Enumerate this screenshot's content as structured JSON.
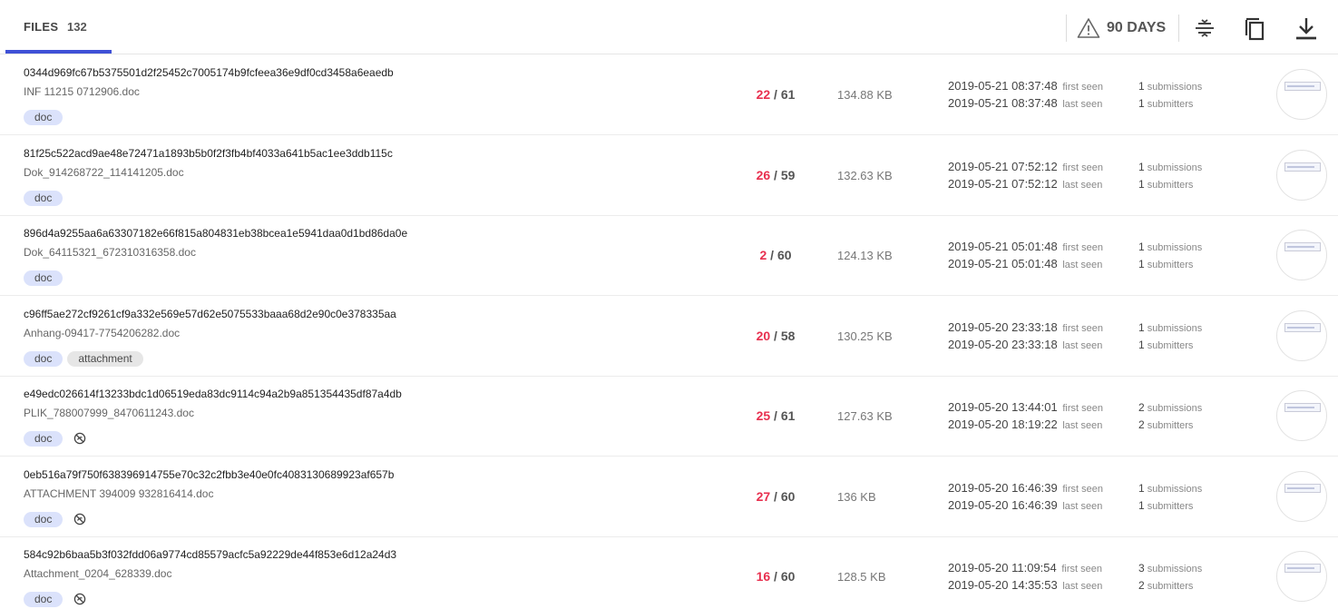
{
  "header": {
    "tab_label": "FILES",
    "tab_count": "132",
    "days_label": "90 DAYS",
    "icons": [
      "warning-triangle-icon",
      "filter-icon",
      "copy-icon",
      "download-icon"
    ],
    "accent_color": "#3f51d6"
  },
  "rows": [
    {
      "hash": "0344d969fc67b5375501d2f25452c7005174b9fcfeea36e9df0cd3458a6eaedb",
      "name": "INF 11215 0712906.doc",
      "tags": [
        "doc"
      ],
      "has_icon": false,
      "det_pos": "22",
      "det_total": "61",
      "size": "134.88 KB",
      "first_seen": "2019-05-21 08:37:48",
      "first_label": "first seen",
      "last_seen": "2019-05-21 08:37:48",
      "last_label": "last seen",
      "submissions": "1",
      "submissions_label": "submissions",
      "submitters": "1",
      "submitters_label": "submitters"
    },
    {
      "hash": "81f25c522acd9ae48e72471a1893b5b0f2f3fb4bf4033a641b5ac1ee3ddb115c",
      "name": "Dok_914268722_114141205.doc",
      "tags": [
        "doc"
      ],
      "has_icon": false,
      "det_pos": "26",
      "det_total": "59",
      "size": "132.63 KB",
      "first_seen": "2019-05-21 07:52:12",
      "first_label": "first seen",
      "last_seen": "2019-05-21 07:52:12",
      "last_label": "last seen",
      "submissions": "1",
      "submissions_label": "submissions",
      "submitters": "1",
      "submitters_label": "submitters"
    },
    {
      "hash": "896d4a9255aa6a63307182e66f815a804831eb38bcea1e5941daa0d1bd86da0e",
      "name": "Dok_64115321_672310316358.doc",
      "tags": [
        "doc"
      ],
      "has_icon": false,
      "det_pos": "2",
      "det_total": "60",
      "size": "124.13 KB",
      "first_seen": "2019-05-21 05:01:48",
      "first_label": "first seen",
      "last_seen": "2019-05-21 05:01:48",
      "last_label": "last seen",
      "submissions": "1",
      "submissions_label": "submissions",
      "submitters": "1",
      "submitters_label": "submitters"
    },
    {
      "hash": "c96ff5ae272cf9261cf9a332e569e57d62e5075533baaa68d2e90c0e378335aa",
      "name": "Anhang-09417-7754206282.doc",
      "tags": [
        "doc",
        "attachment"
      ],
      "has_icon": false,
      "det_pos": "20",
      "det_total": "58",
      "size": "130.25 KB",
      "first_seen": "2019-05-20 23:33:18",
      "first_label": "first seen",
      "last_seen": "2019-05-20 23:33:18",
      "last_label": "last seen",
      "submissions": "1",
      "submissions_label": "submissions",
      "submitters": "1",
      "submitters_label": "submitters"
    },
    {
      "hash": "e49edc026614f13233bdc1d06519eda83dc9114c94a2b9a851354435df87a4db",
      "name": "PLIK_788007999_8470611243.doc",
      "tags": [
        "doc"
      ],
      "has_icon": true,
      "det_pos": "25",
      "det_total": "61",
      "size": "127.63 KB",
      "first_seen": "2019-05-20 13:44:01",
      "first_label": "first seen",
      "last_seen": "2019-05-20 18:19:22",
      "last_label": "last seen",
      "submissions": "2",
      "submissions_label": "submissions",
      "submitters": "2",
      "submitters_label": "submitters"
    },
    {
      "hash": "0eb516a79f750f638396914755e70c32c2fbb3e40e0fc4083130689923af657b",
      "name": "ATTACHMENT 394009 932816414.doc",
      "tags": [
        "doc"
      ],
      "has_icon": true,
      "det_pos": "27",
      "det_total": "60",
      "size": "136 KB",
      "first_seen": "2019-05-20 16:46:39",
      "first_label": "first seen",
      "last_seen": "2019-05-20 16:46:39",
      "last_label": "last seen",
      "submissions": "1",
      "submissions_label": "submissions",
      "submitters": "1",
      "submitters_label": "submitters"
    },
    {
      "hash": "584c92b6baa5b3f032fdd06a9774cd85579acfc5a92229de44f853e6d12a24d3",
      "name": "Attachment_0204_628339.doc",
      "tags": [
        "doc"
      ],
      "has_icon": true,
      "det_pos": "16",
      "det_total": "60",
      "size": "128.5 KB",
      "first_seen": "2019-05-20 11:09:54",
      "first_label": "first seen",
      "last_seen": "2019-05-20 14:35:53",
      "last_label": "last seen",
      "submissions": "3",
      "submissions_label": "submissions",
      "submitters": "2",
      "submitters_label": "submitters"
    }
  ],
  "colors": {
    "detection_positive": "#e8304f",
    "tag_doc_bg": "#dbe2fb",
    "tag_other_bg": "#e6e6e6"
  }
}
